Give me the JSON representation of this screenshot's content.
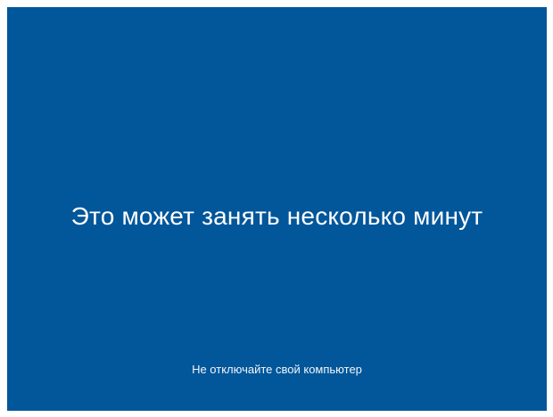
{
  "screen": {
    "background_color": "#02569a",
    "text_color": "#ffffff",
    "main_message": "Это может занять несколько минут",
    "sub_message": "Не отключайте свой компьютер"
  }
}
